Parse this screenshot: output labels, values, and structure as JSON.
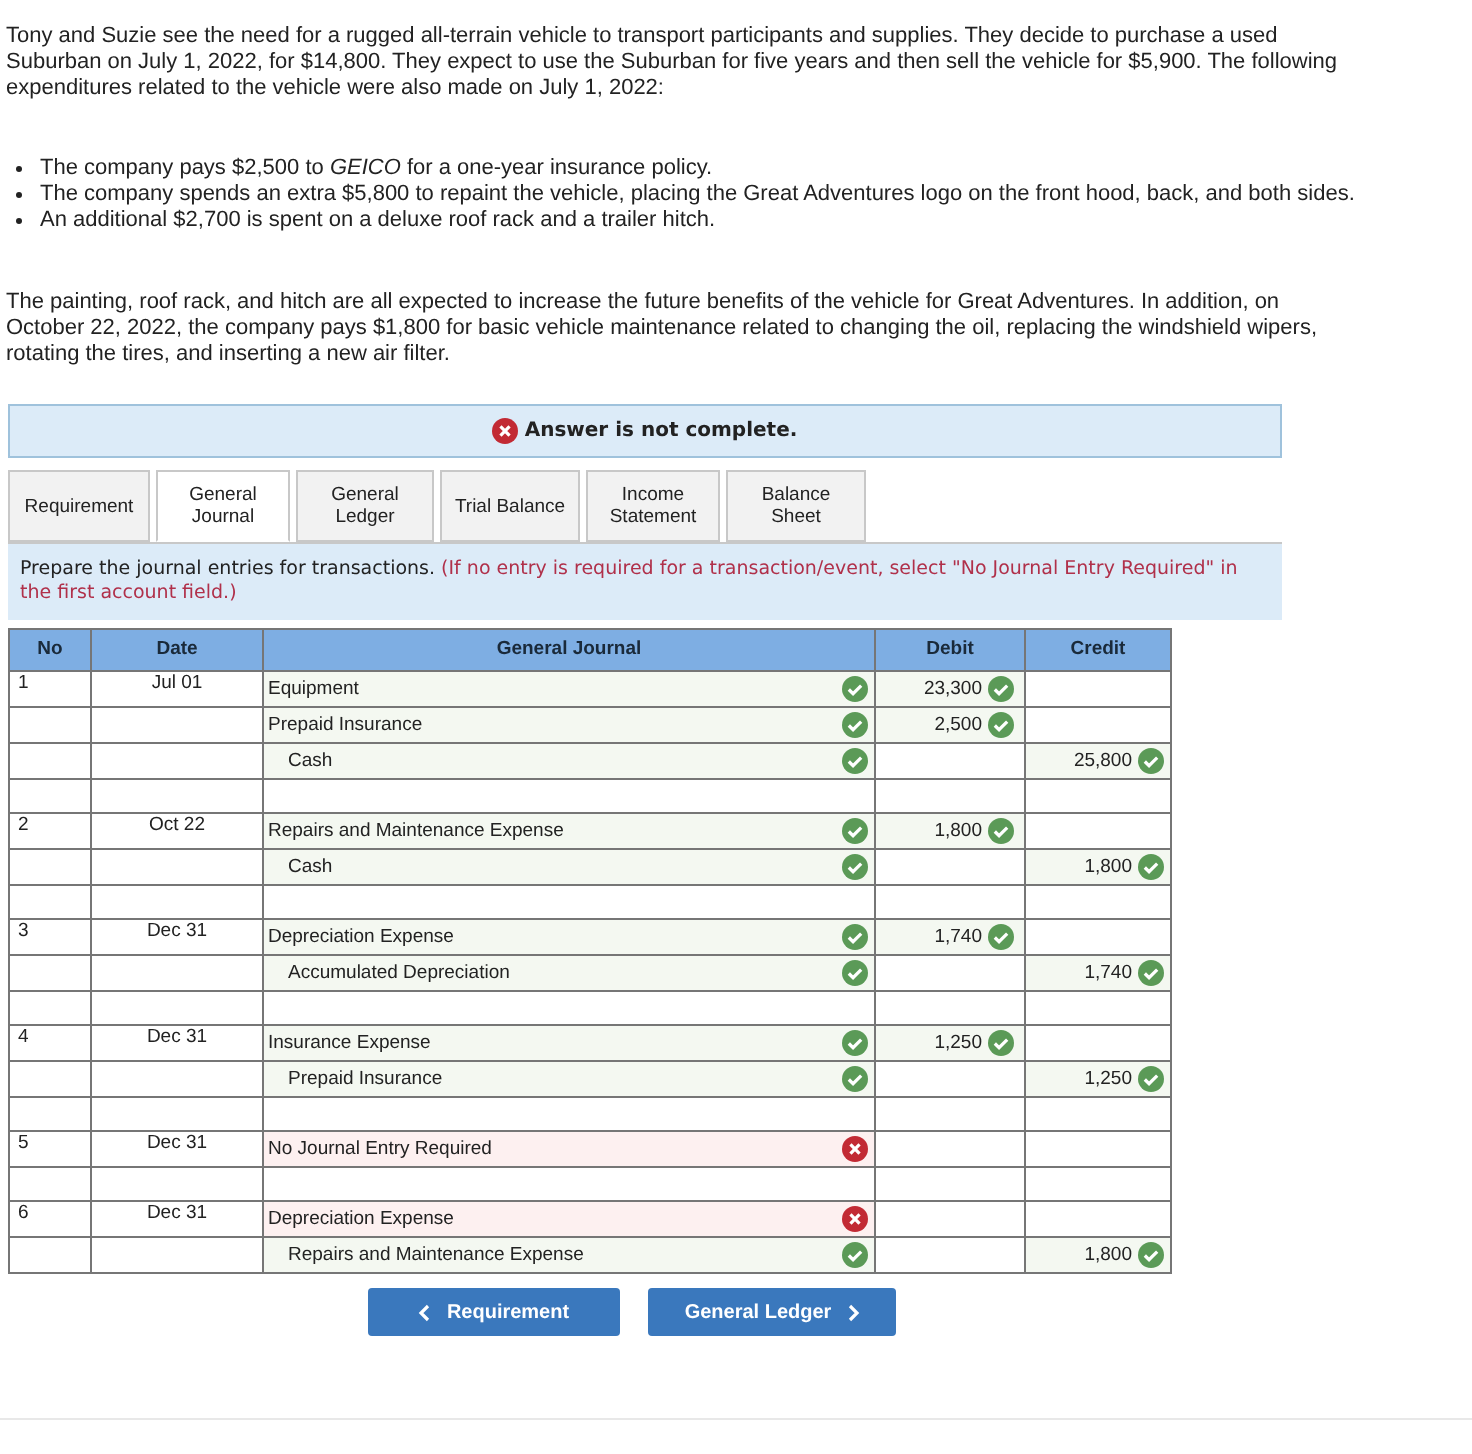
{
  "problem": {
    "intro": "Tony and Suzie see the need for a rugged all-terrain vehicle to transport participants and supplies. They decide to purchase a used Suburban on July 1, 2022, for $14,800. They expect to use the Suburban for five years and then sell the vehicle for $5,900. The following expenditures related to the vehicle were also made on July 1, 2022:",
    "bullets": [
      "The company pays $2,500 to *GEICO* for a one-year insurance policy.",
      "The company spends an extra $5,800 to repaint the vehicle, placing the Great Adventures logo on the front hood, back, and both sides.",
      "An additional $2,700 is spent on a deluxe roof rack and a trailer hitch."
    ],
    "closing": "The painting, roof rack, and hitch are all expected to increase the future benefits of the vehicle for Great Adventures. In addition, on October 22, 2022, the company pays $1,800 for basic vehicle maintenance related to changing the oil, replacing the windshield wipers, rotating the tires, and inserting a new air filter."
  },
  "answer_banner": {
    "complete": false,
    "text": "Answer is not complete."
  },
  "tabs": [
    {
      "label": "Requirement",
      "selected": false
    },
    {
      "label": "General Journal",
      "selected": true
    },
    {
      "label": "General Ledger",
      "selected": false
    },
    {
      "label": "Trial Balance",
      "selected": false
    },
    {
      "label": "Income Statement",
      "selected": false
    },
    {
      "label": "Balance Sheet",
      "selected": false
    }
  ],
  "instruction": {
    "text": "Prepare the journal entries for transactions.",
    "note": "(If no entry is required for a transaction/event, select \"No Journal Entry Required\" in the first account field.)"
  },
  "journal": {
    "columns": [
      "No",
      "Date",
      "General Journal",
      "Debit",
      "Credit"
    ],
    "entries": [
      {
        "no": "1",
        "date": "Jul 01",
        "lines": [
          {
            "account": "Equipment",
            "indented": false,
            "account_correct": true,
            "debit": "23,300",
            "debit_correct": true
          },
          {
            "account": "Prepaid Insurance",
            "indented": false,
            "account_correct": true,
            "debit": "2,500",
            "debit_correct": true
          },
          {
            "account": "Cash",
            "indented": true,
            "account_correct": true,
            "credit": "25,800",
            "credit_correct": true
          }
        ]
      },
      {
        "no": "2",
        "date": "Oct 22",
        "lines": [
          {
            "account": "Repairs and Maintenance Expense",
            "indented": false,
            "account_correct": true,
            "debit": "1,800",
            "debit_correct": true
          },
          {
            "account": "Cash",
            "indented": true,
            "account_correct": true,
            "credit": "1,800",
            "credit_correct": true
          }
        ]
      },
      {
        "no": "3",
        "date": "Dec 31",
        "lines": [
          {
            "account": "Depreciation Expense",
            "indented": false,
            "account_correct": true,
            "debit": "1,740",
            "debit_correct": true
          },
          {
            "account": "Accumulated Depreciation",
            "indented": true,
            "account_correct": true,
            "credit": "1,740",
            "credit_correct": true
          }
        ]
      },
      {
        "no": "4",
        "date": "Dec 31",
        "lines": [
          {
            "account": "Insurance Expense",
            "indented": false,
            "account_correct": true,
            "debit": "1,250",
            "debit_correct": true
          },
          {
            "account": "Prepaid Insurance",
            "indented": true,
            "account_correct": true,
            "credit": "1,250",
            "credit_correct": true
          }
        ]
      },
      {
        "no": "5",
        "date": "Dec 31",
        "lines": [
          {
            "account": "No Journal Entry Required",
            "indented": false,
            "account_correct": false
          }
        ]
      },
      {
        "no": "6",
        "date": "Dec 31",
        "lines": [
          {
            "account": "Depreciation Expense",
            "indented": false,
            "account_correct": false
          },
          {
            "account": "Repairs and Maintenance Expense",
            "indented": true,
            "account_correct": true,
            "credit": "1,800",
            "credit_correct": true
          }
        ]
      }
    ]
  },
  "navigation": {
    "previous": "Requirement",
    "next": "General Ledger"
  }
}
